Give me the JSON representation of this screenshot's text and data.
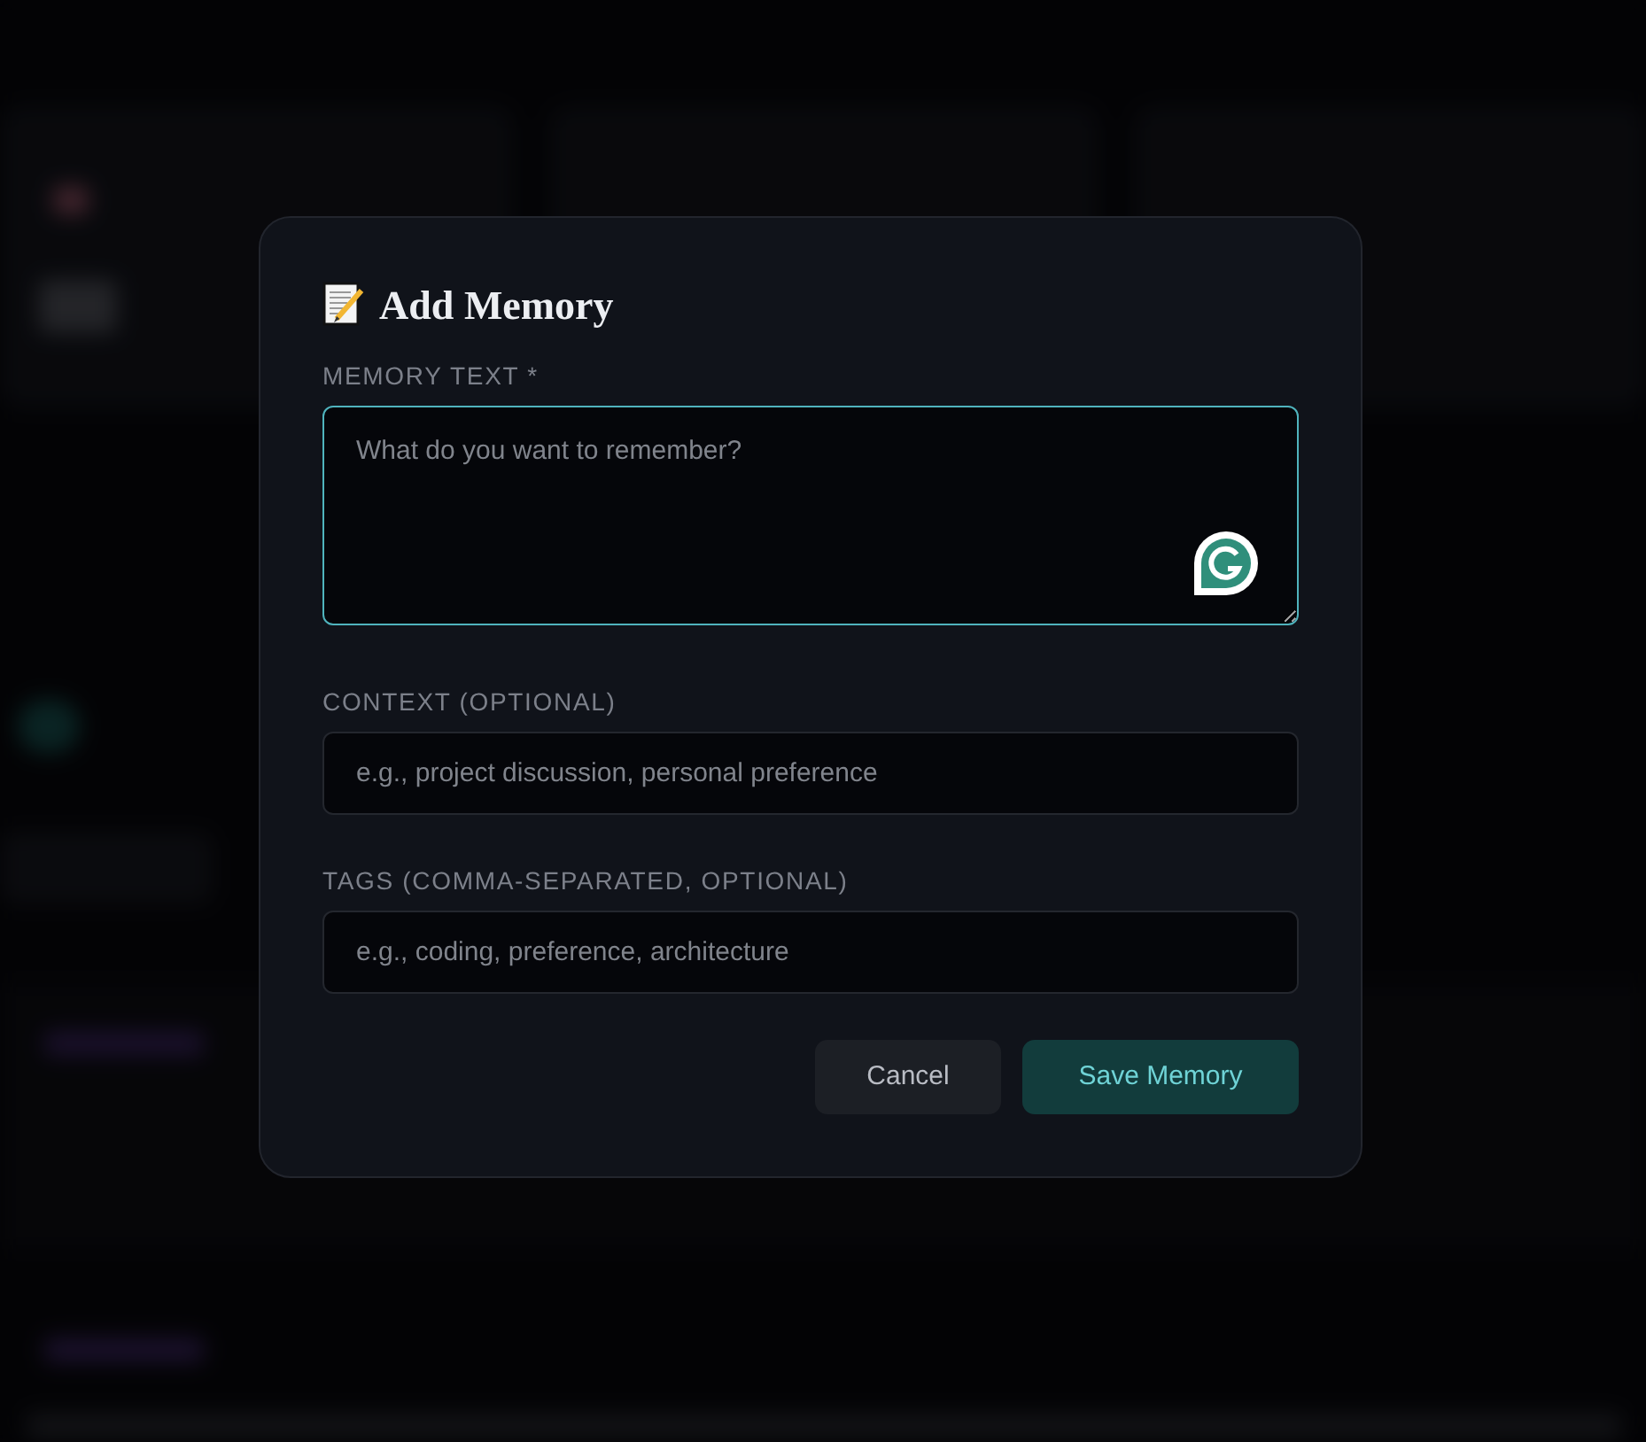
{
  "dialog": {
    "title": "Add Memory",
    "fields": [
      {
        "kind": "textarea",
        "label": "MEMORY TEXT *",
        "placeholder": "What do you want to remember?",
        "focused": true
      },
      {
        "kind": "input",
        "label": "CONTEXT (OPTIONAL)",
        "placeholder": "e.g., project discussion, personal preference",
        "focused": false
      },
      {
        "kind": "input",
        "label": "TAGS (COMMA-SEPARATED, OPTIONAL)",
        "placeholder": "e.g., coding, preference, architecture",
        "focused": false
      }
    ],
    "buttons": [
      {
        "kind": "secondary",
        "label": "Cancel"
      },
      {
        "kind": "primary",
        "label": "Save Memory"
      }
    ]
  }
}
